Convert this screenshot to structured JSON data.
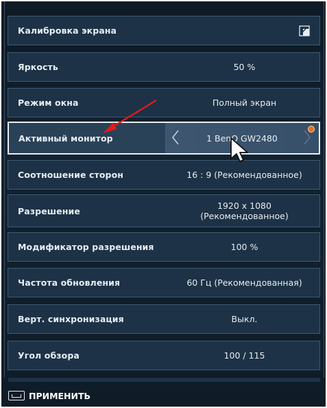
{
  "settings": {
    "rows": [
      {
        "label": "Калибровка экрана",
        "value": ""
      },
      {
        "label": "Яркость",
        "value": "50 %"
      },
      {
        "label": "Режим окна",
        "value": "Полный экран"
      },
      {
        "label": "Активный монитор",
        "value": "1 BenQ GW2480"
      },
      {
        "label": "Соотношение сторон",
        "value": "16 : 9 (Рекомендованное)"
      },
      {
        "label": "Разрешение",
        "value": "1920 x 1080\n(Рекомендованное)"
      },
      {
        "label": "Модификатор разрешения",
        "value": "100 %"
      },
      {
        "label": "Частота обновления",
        "value": "60 Гц (Рекомендованная)"
      },
      {
        "label": "Верт. синхронизация",
        "value": "Выкл."
      },
      {
        "label": "Угол обзора",
        "value": "100 / 115"
      }
    ]
  },
  "footer": {
    "apply_label": "ПРИМЕНИТЬ",
    "apply_key_icon": "spacebar-key-icon"
  },
  "icons": {
    "calibration": "external-window-icon",
    "prev": "chevron-left-icon",
    "next": "chevron-right-icon",
    "badge": "notification-dot-icon",
    "cursor": "mouse-pointer-icon",
    "annotation": "red-arrow-annotation"
  },
  "colors": {
    "background": "#122231",
    "row": "#1d3246",
    "row_border": "#3f5a72",
    "active_border": "#e9eef2",
    "text": "#e6edf3",
    "badge": "#e8701a",
    "annotation": "#e31b1b"
  }
}
